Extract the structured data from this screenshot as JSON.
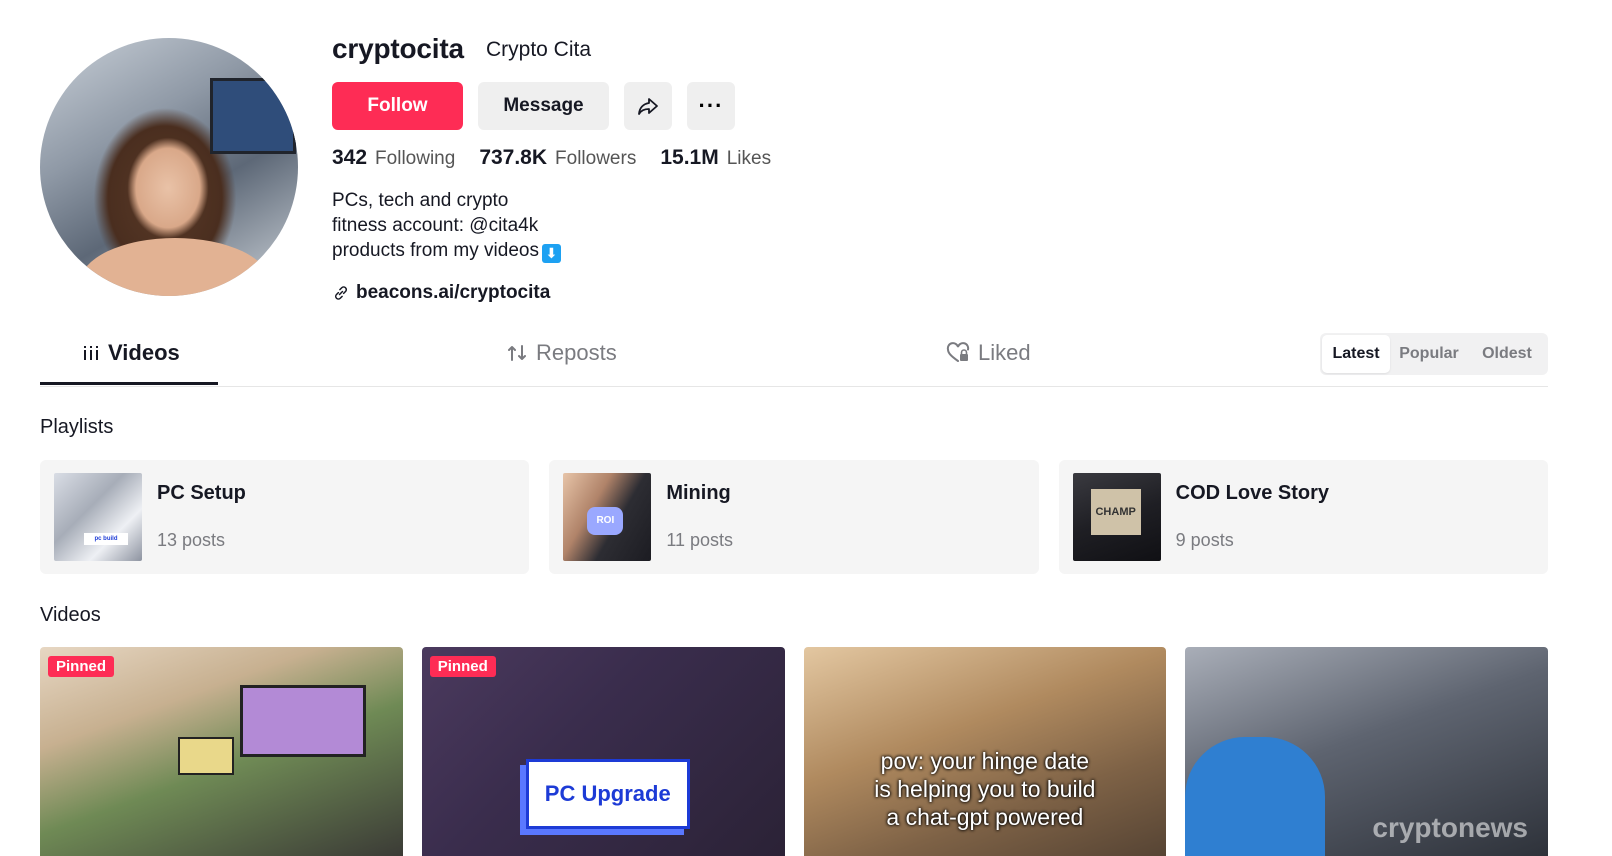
{
  "profile": {
    "username": "cryptocita",
    "display_name": "Crypto Cita",
    "follow_label": "Follow",
    "message_label": "Message",
    "more_label": "···",
    "stats": {
      "following_count": "342",
      "following_label": "Following",
      "followers_count": "737.8K",
      "followers_label": "Followers",
      "likes_count": "15.1M",
      "likes_label": "Likes"
    },
    "bio": {
      "line1": "PCs, tech and crypto",
      "line2": "fitness account: @cita4k",
      "line3": "products from my videos",
      "line3_emoji": "⬇"
    },
    "link": "beacons.ai/cryptocita"
  },
  "tabs": {
    "videos": "Videos",
    "reposts": "Reposts",
    "liked": "Liked"
  },
  "sort": {
    "latest": "Latest",
    "popular": "Popular",
    "oldest": "Oldest"
  },
  "playlists": {
    "title": "Playlists",
    "items": [
      {
        "title": "PC Setup",
        "count": "13 posts",
        "thumb_text": "pc build"
      },
      {
        "title": "Mining",
        "count": "11 posts",
        "thumb_text": "ROI"
      },
      {
        "title": "COD Love Story",
        "count": "9 posts",
        "thumb_text": "CHAMP"
      }
    ]
  },
  "videos": {
    "title": "Videos",
    "items": [
      {
        "badge": "Pinned"
      },
      {
        "badge": "Pinned",
        "overlay": "PC Upgrade"
      },
      {
        "caption_l1": "pov: your hinge date",
        "caption_l2": "is helping you to build",
        "caption_l3": "a chat-gpt powered"
      },
      {
        "watermark": "cryptonews"
      }
    ]
  },
  "colors": {
    "accent": "#fe2c55",
    "text": "#161823",
    "muted": "#7a7b80",
    "chip_bg": "#efefef"
  }
}
